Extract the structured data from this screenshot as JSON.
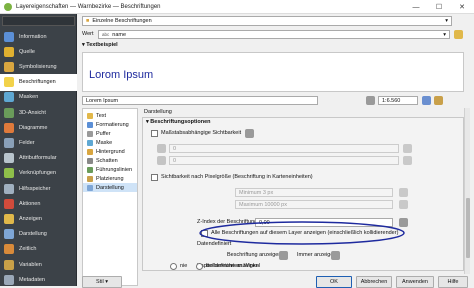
{
  "window": {
    "title": "Layereigenschaften — Warnbezirke — Beschriftungen",
    "min": "—",
    "max": "☐",
    "close": "✕"
  },
  "sidebar": {
    "items": [
      {
        "label": "Information",
        "color": "#5b8fd6"
      },
      {
        "label": "Quelle",
        "color": "#e0b030"
      },
      {
        "label": "Symbolisierung",
        "color": "#d9a640"
      },
      {
        "label": "Beschriftungen",
        "color": "#f2d24a"
      },
      {
        "label": "Masken",
        "color": "#5fa8d3"
      },
      {
        "label": "3D-Ansicht",
        "color": "#6a9b5a"
      },
      {
        "label": "Diagramme",
        "color": "#e07a3b"
      },
      {
        "label": "Felder",
        "color": "#8aa0b8"
      },
      {
        "label": "Attributformular",
        "color": "#b8c4cc"
      },
      {
        "label": "Verknüpfungen",
        "color": "#8fbf4a"
      },
      {
        "label": "Hilfsspeicher",
        "color": "#a0b0c0"
      },
      {
        "label": "Aktionen",
        "color": "#d14b3b"
      },
      {
        "label": "Anzeigen",
        "color": "#e0b84a"
      },
      {
        "label": "Darstellung",
        "color": "#7ea6d6"
      },
      {
        "label": "Zeitlich",
        "color": "#d88a3a"
      },
      {
        "label": "Variablen",
        "color": "#c8a048"
      },
      {
        "label": "Metadaten",
        "color": "#9aa8b8"
      }
    ]
  },
  "labels_mode": "Einzelne Beschriftungen",
  "value": {
    "label": "Wert",
    "field_prefix": "abc",
    "field": "name"
  },
  "preview": {
    "header": "Textbeispiel",
    "sample": "Lorom Ipsum",
    "input": "Lorem Ipsum",
    "scale": "1:6.560"
  },
  "tree": [
    "Text",
    "Formatierung",
    "Puffer",
    "Maske",
    "Hintergrund",
    "Schatten",
    "Führungslinien",
    "Platzierung",
    "Darstellung"
  ],
  "panel": {
    "section": "Darstellung",
    "group": "Beschriftungsoptionen",
    "scale_vis": "Maßstabsabhängige Sichtbarkeit",
    "scale_min": "0",
    "scale_max": "0",
    "pixel_vis": "Sichtbarkeit nach Pixelgröße (Beschriftung in Karteneinheiten)",
    "min_px": "Minimum 3 px",
    "max_px": "Maximum 10000 px",
    "zindex_label": "Z-Index der Beschriftung",
    "zindex_val": "0,00",
    "show_all": "Alle Beschriftungen auf diesem Layer anzeigen (einschließlich kollidierender)",
    "data_defined": "Datendefiniert",
    "show_label": "Beschriftung anzeigen",
    "always_show": "Immer anzeigen",
    "overrun": "Kapitelbereiche anzeigen",
    "radio1": "nie",
    "radio2": "bei definiertem Winkel"
  },
  "footer": {
    "style": "Stil",
    "ok": "OK",
    "cancel": "Abbrechen",
    "apply": "Anwenden",
    "help": "Hilfe"
  },
  "accent": "#1e2a9e"
}
